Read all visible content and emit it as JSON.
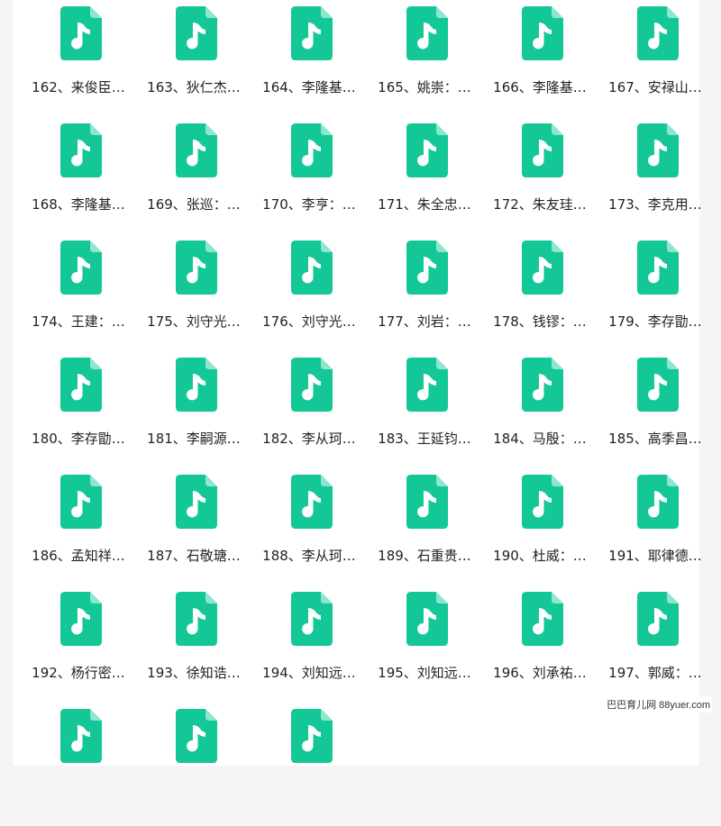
{
  "colors": {
    "icon_fill": "#13c797",
    "icon_fold": "#8fe6cf",
    "label_text": "#222222"
  },
  "icon_name": "music-file-icon",
  "files": [
    {
      "label": "162、来俊臣…"
    },
    {
      "label": "163、狄仁杰…"
    },
    {
      "label": "164、李隆基…"
    },
    {
      "label": "165、姚崇：…"
    },
    {
      "label": "166、李隆基…"
    },
    {
      "label": "167、安禄山…"
    },
    {
      "label": "168、李隆基…"
    },
    {
      "label": "169、张巡：…"
    },
    {
      "label": "170、李亨：…"
    },
    {
      "label": "171、朱全忠…"
    },
    {
      "label": "172、朱友珪…"
    },
    {
      "label": "173、李克用…"
    },
    {
      "label": "174、王建：…"
    },
    {
      "label": "175、刘守光…"
    },
    {
      "label": "176、刘守光…"
    },
    {
      "label": "177、刘岩：…"
    },
    {
      "label": "178、钱镠：…"
    },
    {
      "label": "179、李存勖…"
    },
    {
      "label": "180、李存勖…"
    },
    {
      "label": "181、李嗣源…"
    },
    {
      "label": "182、李从珂…"
    },
    {
      "label": "183、王延钧…"
    },
    {
      "label": "184、马殷：…"
    },
    {
      "label": "185、高季昌…"
    },
    {
      "label": "186、孟知祥…"
    },
    {
      "label": "187、石敬瑭…"
    },
    {
      "label": "188、李从珂…"
    },
    {
      "label": "189、石重贵…"
    },
    {
      "label": "190、杜威：…"
    },
    {
      "label": "191、耶律德…"
    },
    {
      "label": "192、杨行密…"
    },
    {
      "label": "193、徐知诰…"
    },
    {
      "label": "194、刘知远…"
    },
    {
      "label": "195、刘知远…"
    },
    {
      "label": "196、刘承祐…"
    },
    {
      "label": "197、郭威：…"
    },
    {
      "label": ""
    },
    {
      "label": ""
    },
    {
      "label": ""
    }
  ],
  "watermark": "巴巴育儿网 88yuer.com"
}
